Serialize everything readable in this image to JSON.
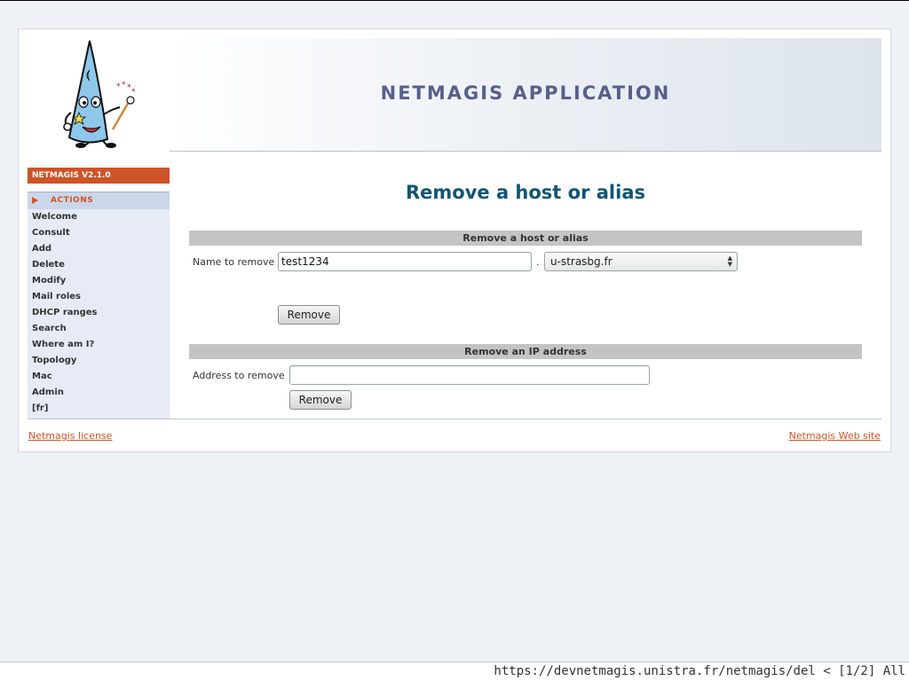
{
  "header": {
    "app_title": "NETMAGIS APPLICATION"
  },
  "sidebar": {
    "version": "NETMAGIS V2.1.0",
    "actions_label": "ACTIONS",
    "items": [
      {
        "label": "Welcome"
      },
      {
        "label": "Consult"
      },
      {
        "label": "Add"
      },
      {
        "label": "Delete"
      },
      {
        "label": "Modify"
      },
      {
        "label": "Mail roles"
      },
      {
        "label": "DHCP ranges"
      },
      {
        "label": "Search"
      },
      {
        "label": "Where am I?"
      },
      {
        "label": "Topology"
      },
      {
        "label": "Mac"
      },
      {
        "label": "Admin"
      },
      {
        "label": "[fr]"
      }
    ]
  },
  "main": {
    "page_title": "Remove a host or alias",
    "host_section": {
      "title": "Remove a host or alias",
      "name_label": "Name to remove",
      "name_value": "test1234",
      "separator": ".",
      "domain_value": "u-strasbg.fr",
      "button_label": "Remove"
    },
    "ip_section": {
      "title": "Remove an IP address",
      "address_label": "Address to remove",
      "address_value": "",
      "button_label": "Remove"
    }
  },
  "footer": {
    "license_link": "Netmagis license",
    "website_link": "Netmagis Web site"
  },
  "statusbar": {
    "text": "https://devnetmagis.unistra.fr/netmagis/del < [1/2] All"
  },
  "colors": {
    "accent": "#cf5328",
    "title": "#0f5574",
    "banner_text": "#585f8c"
  },
  "icons": {
    "logo": "wizard-hat-logo",
    "actions_marker": "triangle-right-icon",
    "select_arrows": "updown-arrows-icon"
  }
}
